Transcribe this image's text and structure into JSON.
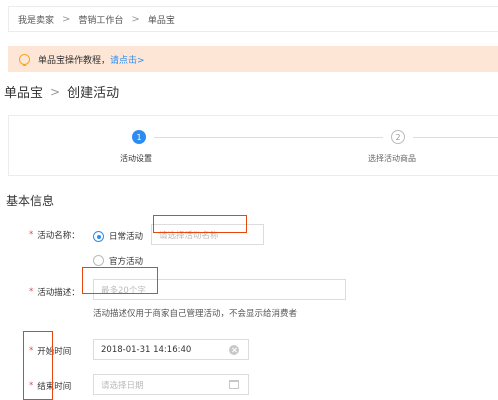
{
  "breadcrumb": {
    "items": [
      "我是卖家",
      "营销工作台",
      "单品宝"
    ],
    "separator": ">"
  },
  "tip": {
    "text": "单品宝操作教程，",
    "link": "请点击>",
    "icon": "lightbulb-icon"
  },
  "page_title": {
    "parent": "单品宝",
    "separator": ">",
    "current": "创建活动"
  },
  "steps": [
    {
      "number": "1",
      "label": "活动设置",
      "state": "active"
    },
    {
      "number": "2",
      "label": "选择活动商品",
      "state": "pending"
    }
  ],
  "section": {
    "title": "基本信息"
  },
  "form": {
    "required_mark": "*",
    "activity_name": {
      "label": "活动名称：",
      "options": [
        {
          "label": "日常活动",
          "checked": true
        },
        {
          "label": "官方活动",
          "checked": false
        }
      ],
      "placeholder": "请选择活动名称"
    },
    "activity_desc": {
      "label": "活动描述：",
      "placeholder": "最多20个字",
      "hint": "活动描述仅用于商家自己管理活动，不会显示给消费者"
    },
    "start_time": {
      "label": "开始时间",
      "value": "2018-01-31 14:16:40"
    },
    "end_time": {
      "label": "结束时间",
      "placeholder": "请选择日期"
    }
  },
  "colors": {
    "accent": "#2d8cf0",
    "required": "#e8454b",
    "annotation": "#e8470c",
    "tip_background": "#fde6d6"
  }
}
